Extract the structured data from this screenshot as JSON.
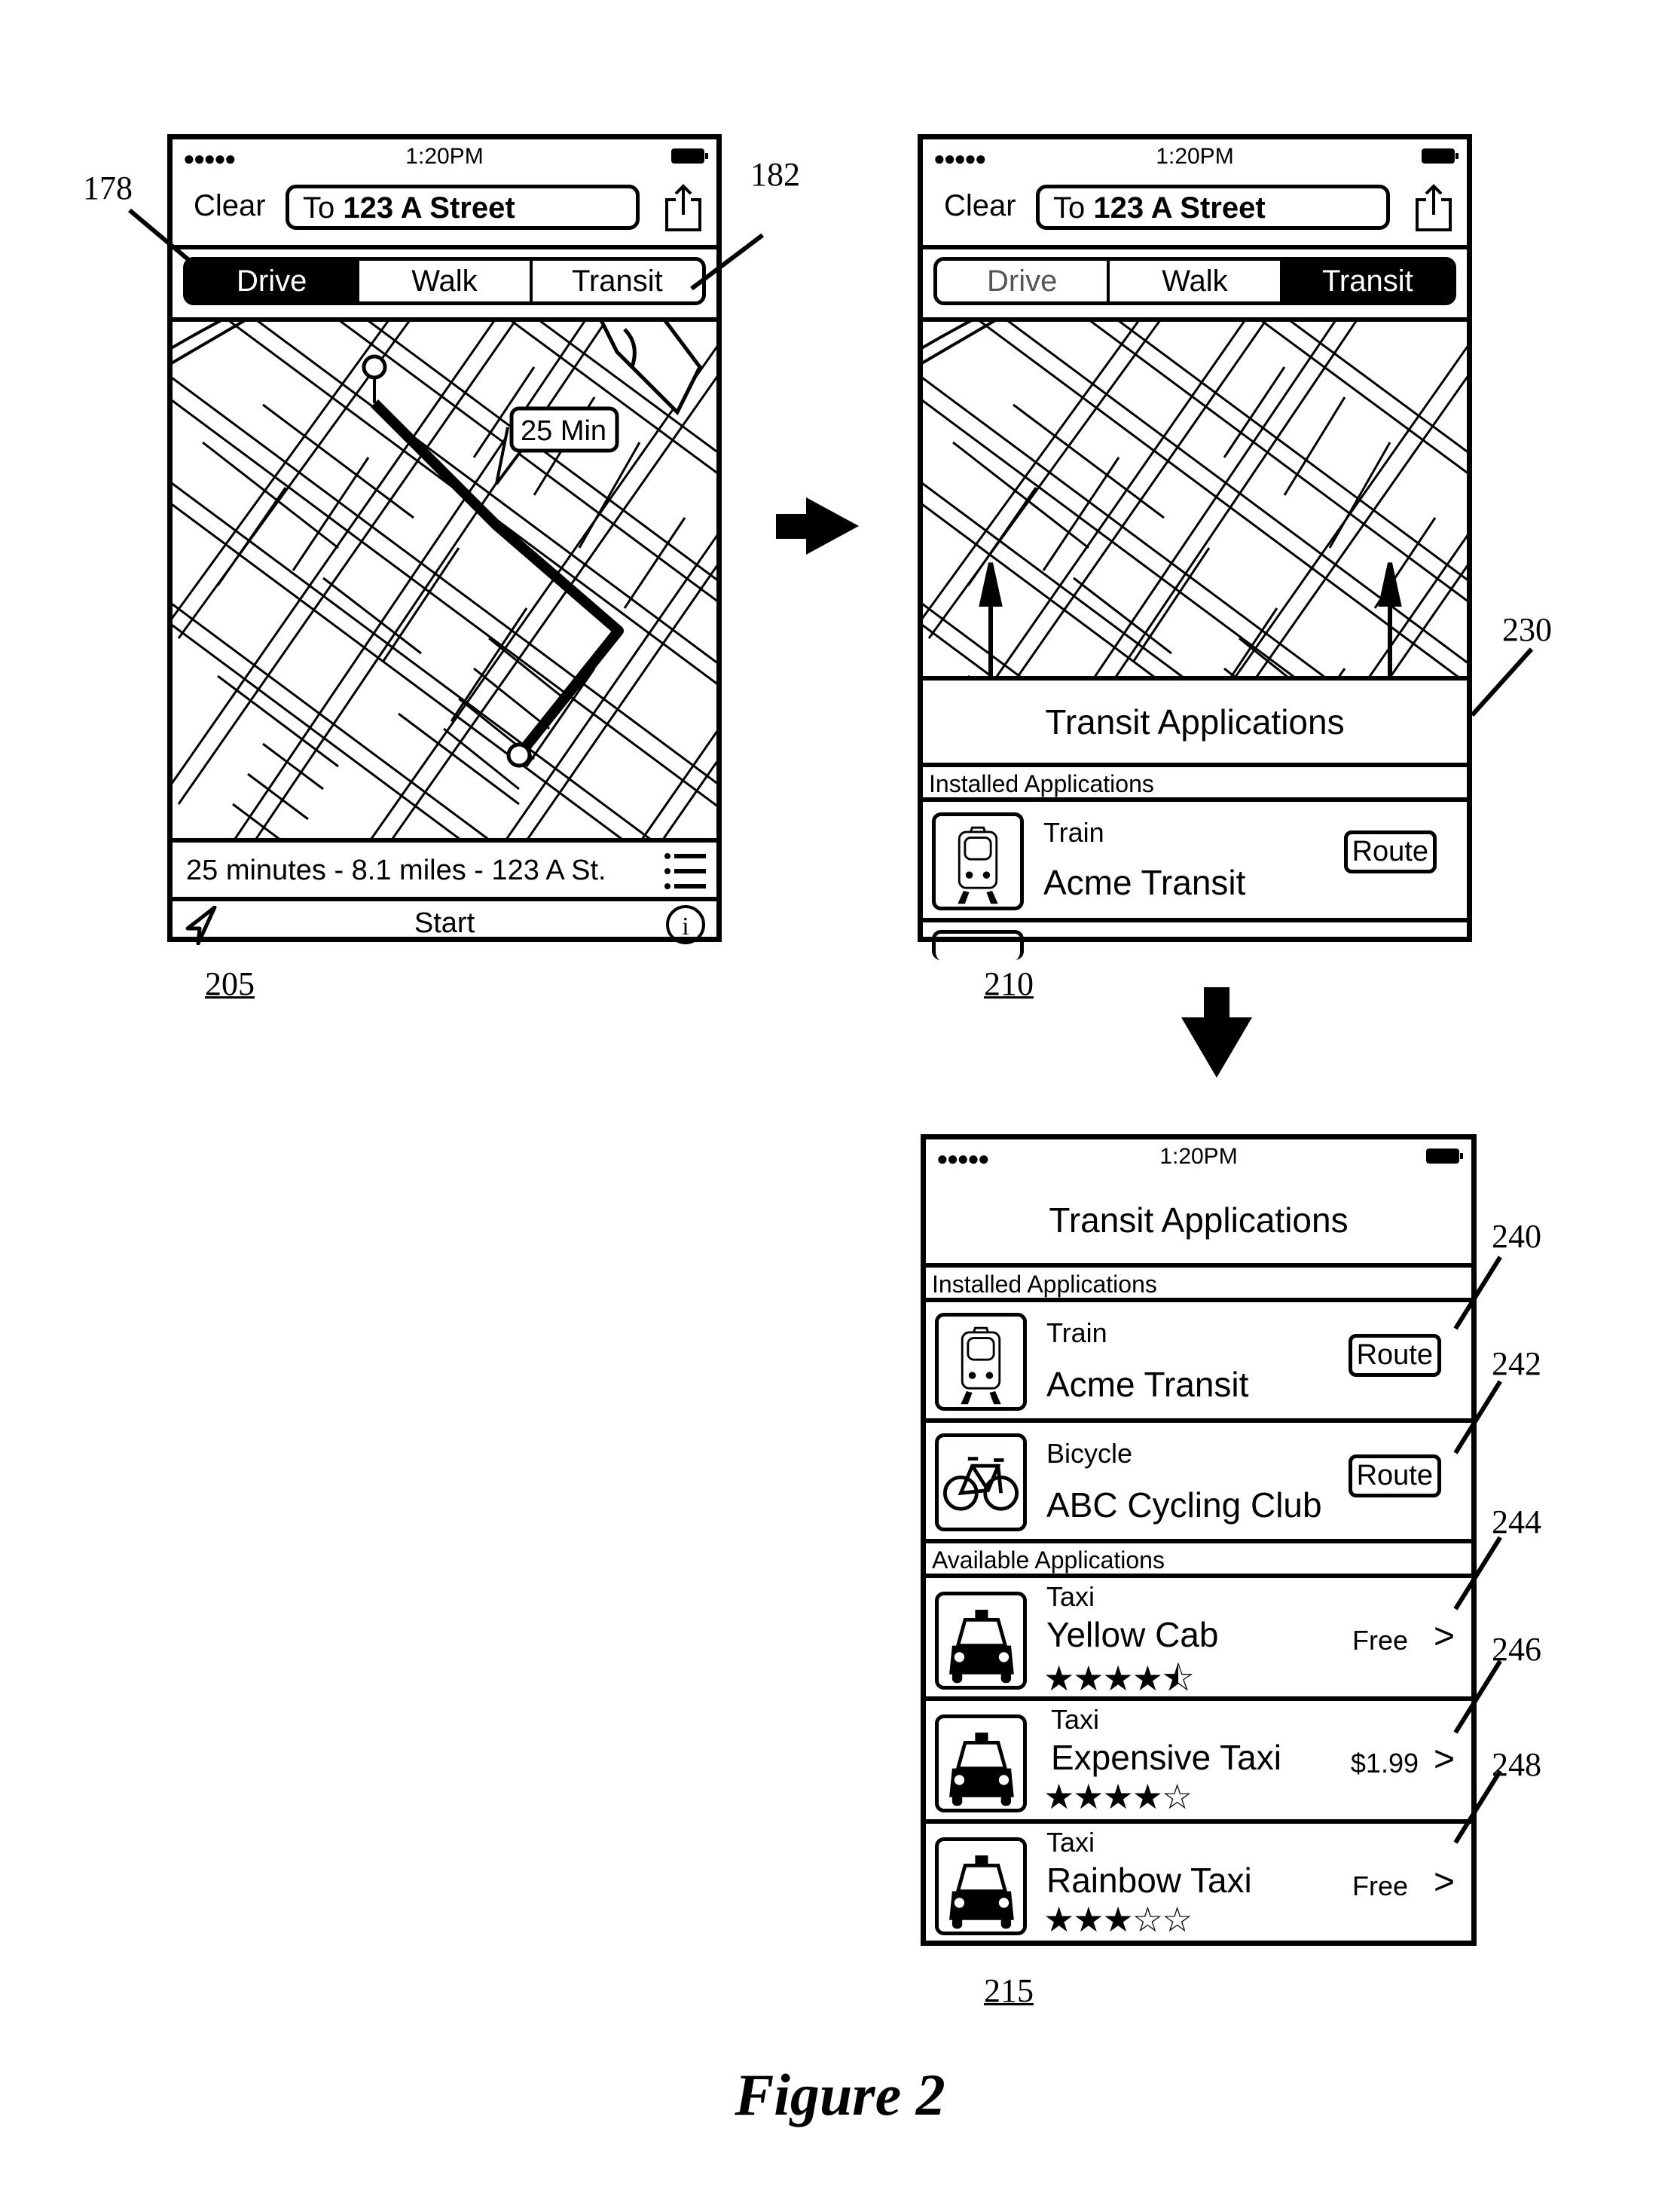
{
  "figure": {
    "caption": "Figure 2",
    "flow_arrows": [
      "right-arrow",
      "down-arrow"
    ]
  },
  "status_bar": {
    "signal": "●●●●●",
    "time": "1:20PM",
    "battery_icon": "battery-full-icon"
  },
  "screen_205": {
    "ref": "205",
    "clear_label": "Clear",
    "destination_prefix": "To",
    "destination": "123 A Street",
    "share_icon": "share-icon",
    "modes": [
      {
        "label": "Drive",
        "selected": true
      },
      {
        "label": "Walk",
        "selected": false
      },
      {
        "label": "Transit",
        "selected": false
      }
    ],
    "route_badge": "25 Min",
    "route_summary": "25 minutes - 8.1 miles - 123 A St.",
    "list_icon": "list-icon",
    "start_label": "Start",
    "location_icon": "location-arrow-icon",
    "info_icon": "info-icon",
    "callouts": [
      {
        "ref": "178",
        "target": "Drive mode button"
      },
      {
        "ref": "182",
        "target": "Transit mode button"
      }
    ]
  },
  "screen_210": {
    "ref": "210",
    "clear_label": "Clear",
    "destination_prefix": "To",
    "destination": "123 A Street",
    "modes": [
      {
        "label": "Drive",
        "selected": false
      },
      {
        "label": "Walk",
        "selected": false
      },
      {
        "label": "Transit",
        "selected": true
      }
    ],
    "panel_title": "Transit Applications",
    "section_installed": "Installed Applications",
    "apps": [
      {
        "category": "Train",
        "name": "Acme Transit",
        "action": "Route",
        "icon": "train-icon"
      }
    ],
    "callouts": [
      {
        "ref": "230",
        "target": "Transit applications panel"
      }
    ]
  },
  "screen_215": {
    "ref": "215",
    "title": "Transit Applications",
    "section_installed": "Installed Applications",
    "installed_apps": [
      {
        "category": "Train",
        "name": "Acme Transit",
        "action": "Route",
        "icon": "train-icon",
        "ref": "240"
      },
      {
        "category": "Bicycle",
        "name": "ABC Cycling Club",
        "action": "Route",
        "icon": "bicycle-icon",
        "ref": "242"
      }
    ],
    "section_available": "Available Applications",
    "available_apps": [
      {
        "category": "Taxi",
        "name": "Yellow Cab",
        "price": "Free",
        "rating": 4.5,
        "stars": "★★★★⯪",
        "icon": "taxi-icon",
        "ref": "244"
      },
      {
        "category": "Taxi",
        "name": "Expensive Taxi",
        "price": "$1.99",
        "rating": 4,
        "stars": "★★★★☆",
        "icon": "taxi-icon",
        "ref": "246"
      },
      {
        "category": "Taxi",
        "name": "Rainbow Taxi",
        "price": "Free",
        "rating": 3,
        "stars": "★★★☆☆",
        "icon": "taxi-icon",
        "ref": "248"
      }
    ],
    "chevron": ">"
  }
}
